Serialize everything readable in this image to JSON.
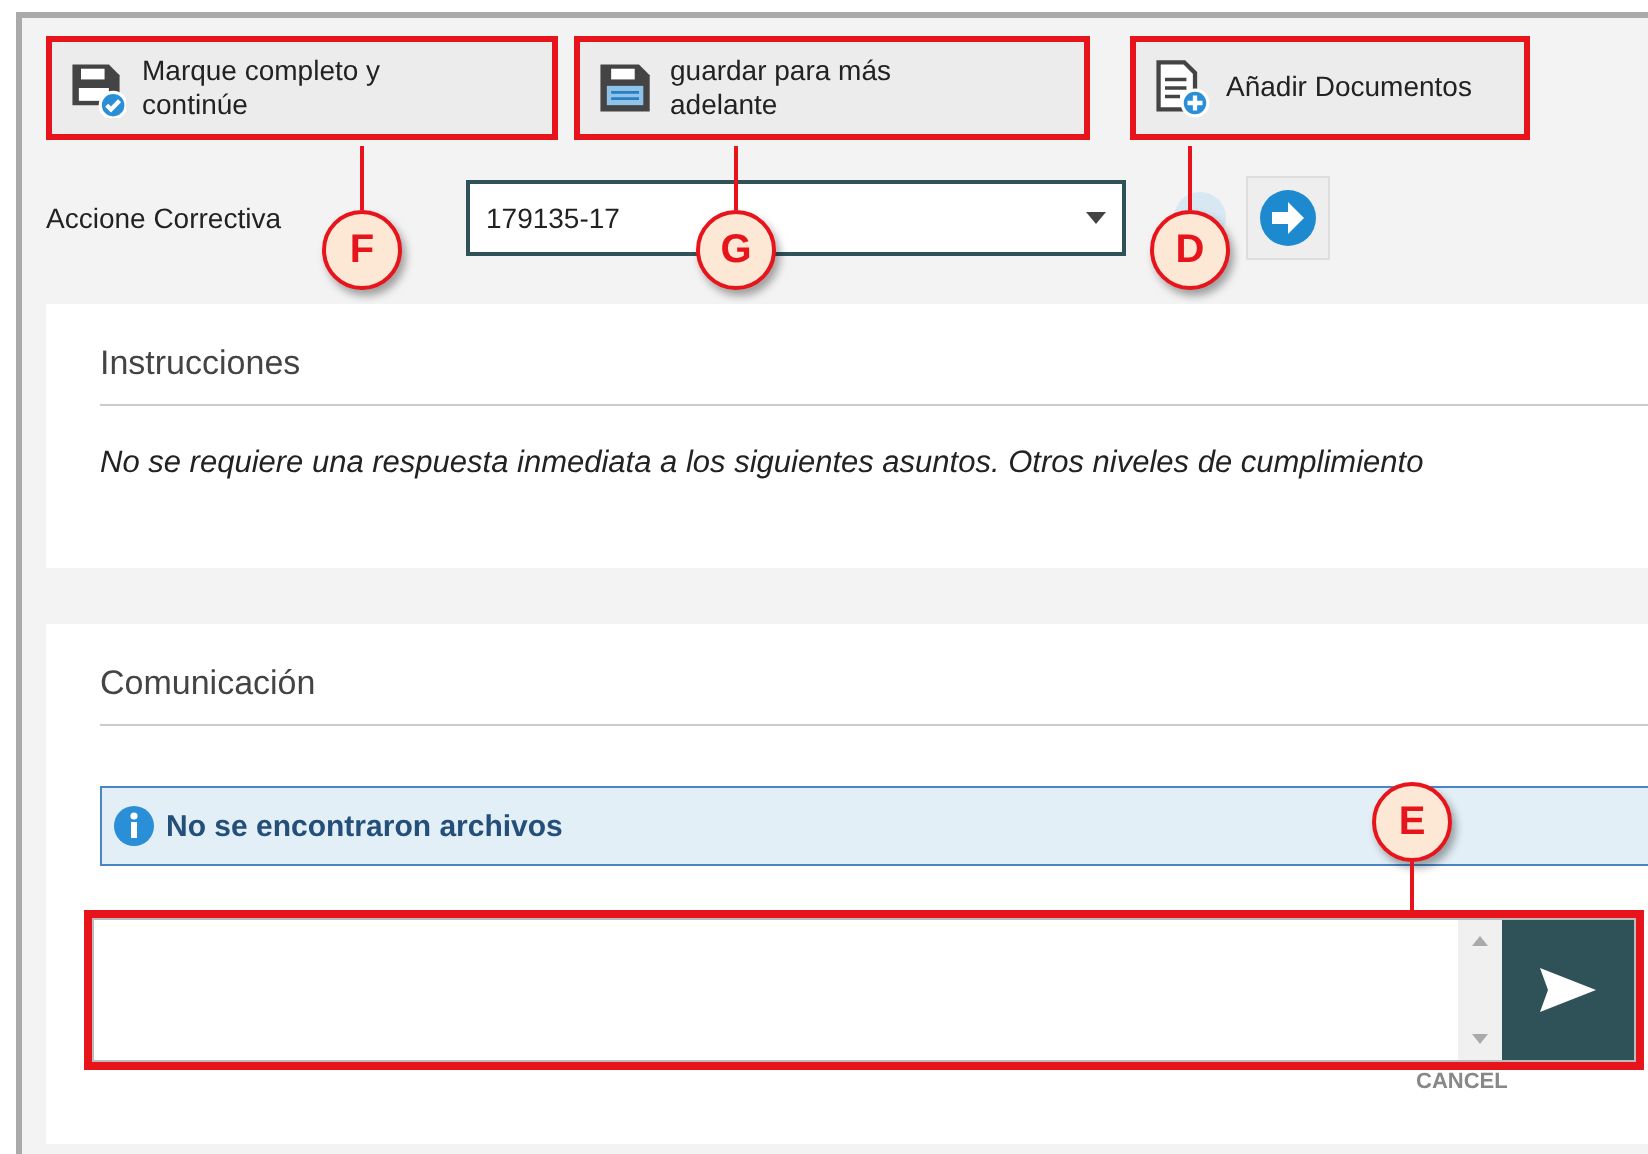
{
  "toolbar": [
    {
      "kind": "complete",
      "label": "Marque completo y continúe",
      "highlighted": true,
      "callout": "F"
    },
    {
      "kind": "save",
      "label": "guardar para más adelante",
      "highlighted": true,
      "callout": "G"
    },
    {
      "kind": "add",
      "label": "Añadir Documentos",
      "highlighted": true,
      "callout": "D"
    }
  ],
  "action": {
    "label": "Accione Correctiva",
    "value": "179135-17"
  },
  "instructions": {
    "title": "Instrucciones",
    "text": "No se requiere una respuesta inmediata a los siguientes asuntos. Otros niveles de cumplimiento"
  },
  "communication": {
    "title": "Comunicación",
    "notice": "No se encontraron archivos",
    "comment_highlighted": true,
    "callout": "E",
    "cancel": "CANCEL"
  }
}
